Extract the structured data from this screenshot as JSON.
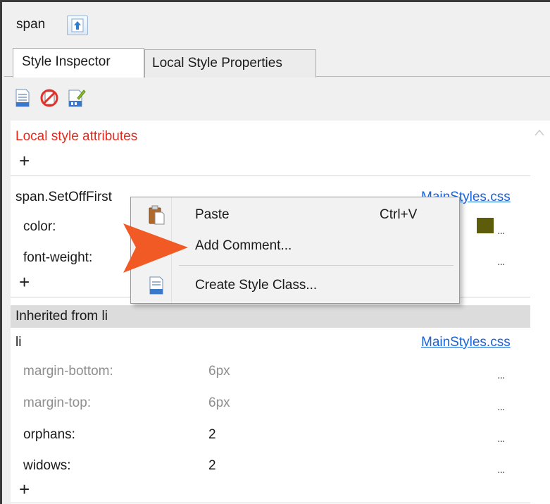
{
  "header": {
    "title": "span"
  },
  "tabs": [
    {
      "label": "Style Inspector",
      "active": true
    },
    {
      "label": "Local Style Properties",
      "active": false
    }
  ],
  "toolbar": {
    "icons": [
      "new-stylesheet-icon",
      "no-style-icon",
      "edit-stylesheet-icon"
    ]
  },
  "local": {
    "heading": "Local style attributes"
  },
  "rule1": {
    "selector": "span.SetOffFirst",
    "source": "MainStyles.css",
    "props": [
      {
        "name": "color:",
        "swatch": "#5d5c0a"
      },
      {
        "name": "font-weight:"
      }
    ]
  },
  "inherited": {
    "heading": "Inherited from li",
    "selector": "li",
    "source": "MainStyles.css",
    "props": [
      {
        "name": "margin-bottom:",
        "value": "6px"
      },
      {
        "name": "margin-top:",
        "value": "6px"
      },
      {
        "name": "orphans:",
        "value": "2"
      },
      {
        "name": "widows:",
        "value": "2"
      }
    ]
  },
  "ellipsis": "...",
  "add": "+",
  "context_menu": {
    "items": [
      {
        "label": "Paste",
        "shortcut": "Ctrl+V",
        "icon": "paste-icon"
      },
      {
        "label": "Add Comment..."
      },
      {
        "label": "Create Style Class...",
        "icon": "create-class-icon"
      }
    ]
  },
  "colors": {
    "accent": "#f15a24",
    "link": "#1a62d8",
    "heading_red": "#e8271b"
  }
}
